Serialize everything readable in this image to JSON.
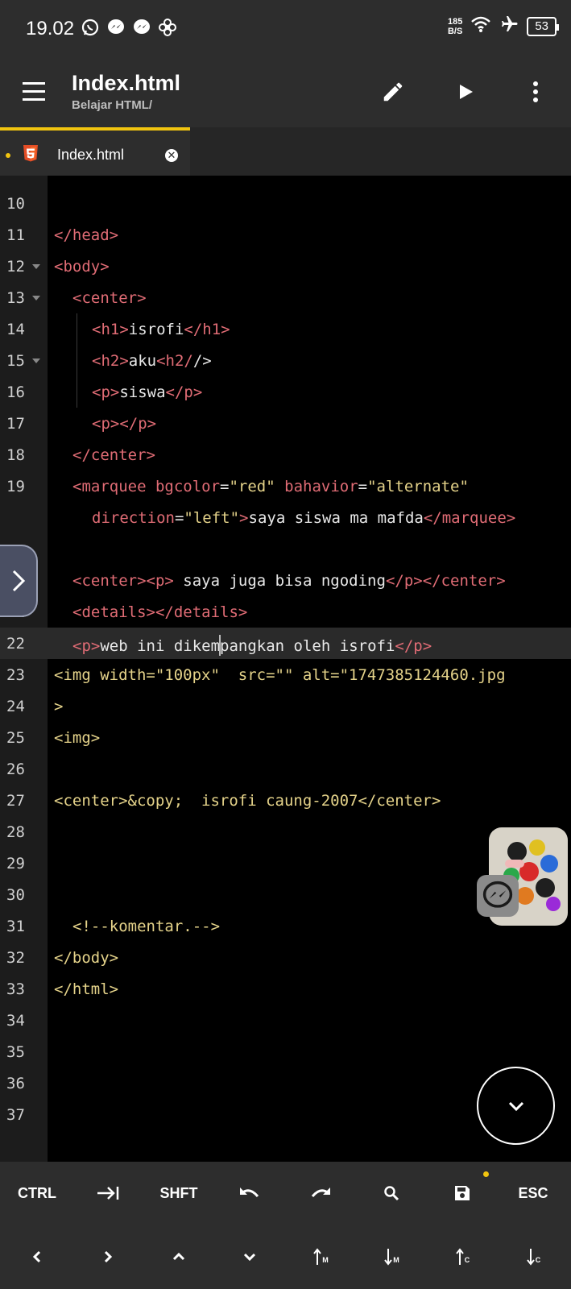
{
  "status_bar": {
    "time": "19.02",
    "net_speed_value": "185",
    "net_speed_unit": "B/S",
    "battery": "53"
  },
  "app_bar": {
    "title": "Index.html",
    "subtitle": "Belajar HTML/"
  },
  "tab": {
    "label": "Index.html"
  },
  "editor": {
    "active_line": "22",
    "line_numbers": [
      "10",
      "11",
      "12",
      "13",
      "14",
      "15",
      "16",
      "17",
      "18",
      "19",
      "",
      "20",
      "21",
      "22",
      "23",
      "24",
      "25",
      "26",
      "27",
      "28",
      "29",
      "30",
      "31",
      "32",
      "33",
      "34",
      "35",
      "36",
      "37"
    ],
    "code": {
      "l11": "</head>",
      "l12": "<body>",
      "l13": "<center>",
      "l14_open": "<h1>",
      "l14_text": "isrofi",
      "l14_close": "</h1>",
      "l15_open": "<h2>",
      "l15_text": "aku",
      "l15_close": "<h2/",
      "l15_tail": "/>",
      "l16_open": "<p>",
      "l16_text": "siswa",
      "l16_close": "</p>",
      "l17": "<p></p>",
      "l18": "</center>",
      "l19_a": "<marquee ",
      "l19_attr1": "bgcolor",
      "l19_eq1": "=",
      "l19_val1": "\"red\"",
      "l19_sp": " ",
      "l19_attr2": "bahavior",
      "l19_eq2": "=",
      "l19_val2": "\"alternate\"",
      "l19b_attr": "direction",
      "l19b_eq": "=",
      "l19b_val": "\"left\"",
      "l19b_gt": ">",
      "l19b_text": "saya siswa ma mafda",
      "l19b_close": "</marquee>",
      "l20_open": "<center><p>",
      "l20_text": " saya juga bisa ngoding",
      "l20_close": "</p></center>",
      "l21": "<details></details>",
      "l22_open": "<p>",
      "l22_text_a": "web ini dikem",
      "l22_text_b": "pangkan oleh isrofi",
      "l22_close": "</p>",
      "l23": "<img width=\"100px\"  src=\"\" alt=\"1747385124460.jpg",
      "l24": ">",
      "l25": "<img>",
      "l27": "<center>&copy;  isrofi caung-2007</center>",
      "l31": "<!--komentar.-->",
      "l32": "</body>",
      "l33": "</html>"
    }
  },
  "keyboard": {
    "row1": [
      "CTRL",
      "→|",
      "SHFT",
      "undo-icon",
      "redo-icon",
      "search-icon",
      "save-icon",
      "ESC"
    ],
    "row2": [
      "<",
      ">",
      "^",
      "v",
      "↑M",
      "↓M",
      "↑C",
      "↓C"
    ],
    "ctrl": "CTRL",
    "shft": "SHFT",
    "esc": "ESC",
    "tab_glyph": "→|",
    "up_m": "M",
    "down_m": "M",
    "up_c": "C",
    "down_c": "C"
  },
  "colors": {
    "accent": "#f1c40f",
    "tag": "#e06c75",
    "string": "#e5d38a",
    "bar": "#2d2d2d"
  }
}
